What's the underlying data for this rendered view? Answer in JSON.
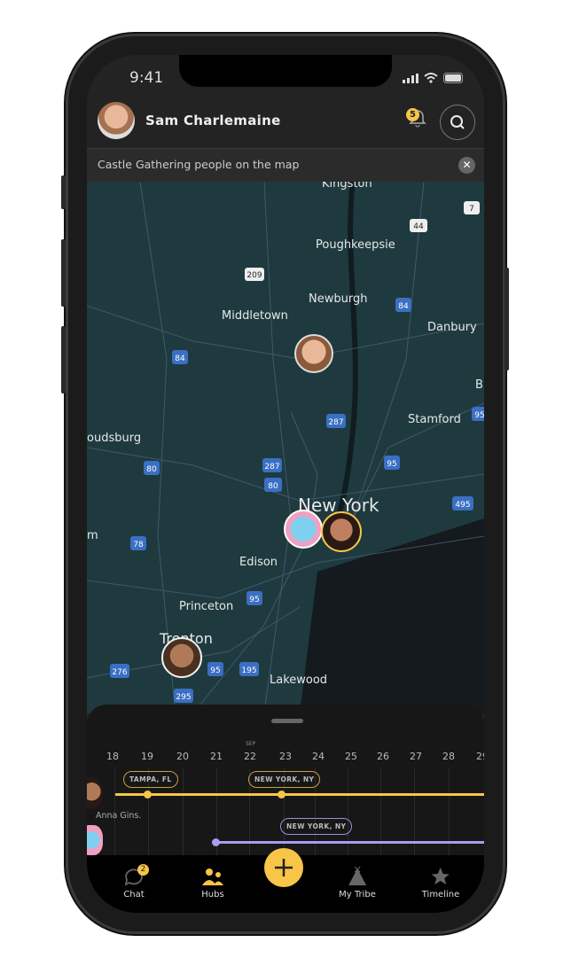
{
  "status": {
    "time": "9:41"
  },
  "header": {
    "user_name": "Sam Charlemaine",
    "notifications": "5"
  },
  "banner": {
    "text": "Castle Gathering people on the map"
  },
  "map": {
    "cities": [
      "Kingston",
      "Poughkeepsie",
      "Newburgh",
      "Middletown",
      "Danbury",
      "Stamford",
      "oudsburg",
      "New York",
      "Edison",
      "Princeton",
      "Trenton",
      "Lakewood",
      "m",
      "B"
    ],
    "shields": [
      "7",
      "44",
      "209",
      "84",
      "84",
      "287",
      "80",
      "287",
      "80",
      "95",
      "495",
      "78",
      "95",
      "276",
      "95",
      "195",
      "295",
      "95"
    ]
  },
  "timeline": {
    "month": "SEP",
    "days": [
      "18",
      "19",
      "20",
      "21",
      "22",
      "23",
      "24",
      "25",
      "26",
      "27",
      "28",
      "29"
    ],
    "rows": [
      {
        "person": "Anna Gins.",
        "color": "#f7c548",
        "stops": [
          "TAMPA, FL",
          "NEW YORK, NY"
        ]
      },
      {
        "person": "",
        "color": "#a99cf0",
        "stops": [
          "NEW YORK, NY"
        ]
      }
    ]
  },
  "nav": {
    "items": [
      {
        "label": "Chat",
        "badge": "2"
      },
      {
        "label": "Hubs"
      },
      {
        "label": "My Tribe"
      },
      {
        "label": "Timeline"
      }
    ]
  },
  "colors": {
    "accent": "#f7c548",
    "purple": "#a99cf0",
    "map": "#1e3a3f"
  }
}
